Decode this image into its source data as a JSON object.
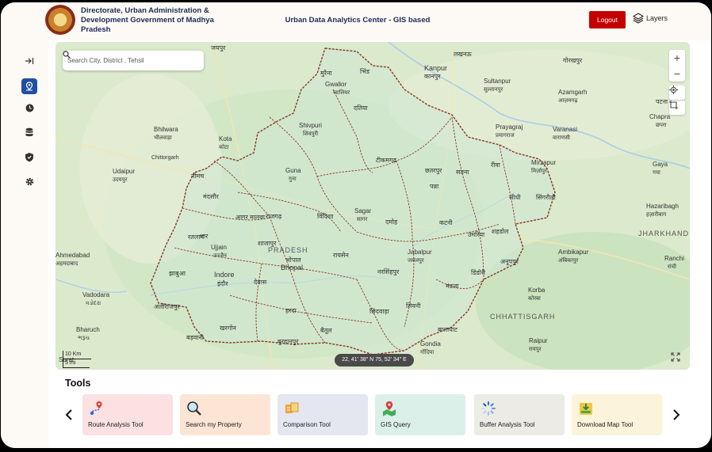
{
  "header": {
    "org_name": "Directorate, Urban Administration & Development Government of Madhya Pradesh",
    "app_title": "Urban Data Analytics Center - GIS based",
    "logout_label": "Logout",
    "layers_label": "Layers"
  },
  "search": {
    "placeholder": "Search City, District , Tehsil"
  },
  "map": {
    "scale_km": "10 Km",
    "scale_mi": "5 mi",
    "coordinates": "22, 41' 38\" N 75, 52' 34\" E",
    "labels": {
      "kanpur": "Kanpur",
      "kanpur_hi": "कानपुर",
      "lucknow": "लखनऊ",
      "gorakhpur": "गोरखपुर",
      "sultanpur": "Sultanpur",
      "sultanpur_hi": "सुल्तानपुर",
      "azamgarh": "Azamgarh",
      "azamgarh_hi": "आज़मगढ़",
      "prayagraj": "Prayagraj",
      "prayagraj_hi": "प्रयागराज",
      "varanasi": "Varanasi",
      "varanasi_hi": "वाराणसी",
      "chapra": "Chapra",
      "chapra_hi": "छपरा",
      "patna": "पटना",
      "mirzapur": "Mirzapur",
      "mirzapur_hi": "मिर्ज़ापुर",
      "gaya": "Gaya",
      "gaya_hi": "गया",
      "hazaribagh": "Hazaribagh",
      "hazaribagh_hi": "हज़ारीबाग",
      "jharkhand": "JHARKHAND",
      "ranchi": "Ranchi",
      "ranchi_hi": "रांची",
      "ambikapur": "Ambikapur",
      "ambikapur_hi": "अंबिकापुर",
      "korba": "Korba",
      "korba_hi": "कोरबा",
      "chhattisgarh": "CHHATTISGARH",
      "raipur": "Raipur",
      "raipur_hi": "रायपुर",
      "gondia": "Gondia",
      "gondia_hi": "गोंदिया",
      "ahmedabad": "Ahmedabad",
      "ahmedabad_hi": "अहमदाबाद",
      "vadodara": "Vadodara",
      "vadodara_hi": "વડોદરા",
      "bharuch": "Bharuch",
      "bharuch_hi": "ભરૂચ",
      "surat": "Surat",
      "surat_hi": "સુરત",
      "udaipur": "Udaipur",
      "udaipur_hi": "उदयपुर",
      "bhilwara": "Bhilwara",
      "bhilwara_hi": "भीलवाड़ा",
      "chittorgarh": "Chittorgarh",
      "kota": "Kota",
      "kota_hi": "कोटा",
      "jaipur": "जयपुर",
      "madhya_pradesh": "PRADESH",
      "indore": "Indore",
      "indore_hi": "इंदौर",
      "bhopal": "Bhopal",
      "bhopal_hi": "भोपाल",
      "jabalpur": "Jabalpur",
      "jabalpur_hi": "जबलपुर",
      "sagar": "Sagar",
      "sagar_hi": "सागर",
      "gwalior": "Gwalior",
      "gwalior_hi": "ग्वालियर",
      "ujjain": "Ujjain",
      "ujjain_hi": "उज्जैन",
      "guna": "Guna",
      "guna_hi": "गुना",
      "shivpuri": "Shivpuri",
      "shivpuri_hi": "शिवपुरी",
      "satna": "सतना",
      "rewa": "रीवा",
      "katni": "कटनी",
      "umaria": "उमरिया",
      "shahdol": "शहडोल",
      "anuppur": "अनूपपुर",
      "dindori": "डिंडोरी",
      "mandla": "मंडला",
      "seoni": "सिवनी",
      "balaghat": "बालाघाट",
      "chhindwara": "छिंदवाड़ा",
      "betul": "बैतूल",
      "harda": "हरदा",
      "narsinghpur": "नरसिंहपुर",
      "raisen": "रायसेन",
      "vidisha": "विदिशा",
      "dewas": "देवास",
      "dhar": "धार",
      "jhabua": "झाबुआ",
      "ratlam": "रतलाम",
      "mandsaur": "मंदसौर",
      "neemuch": "नीमच",
      "khargone": "खरगोन",
      "barwani": "बड़वानी",
      "burhanpur": "बुरहानपुर",
      "damoh": "दमोह",
      "chhatarpur": "छतरपुर",
      "panna": "पन्ना",
      "tikamgarh": "टीकमगढ़",
      "sidhi": "सीधी",
      "singrauli": "सिंगरौली",
      "alirajpur": "अलीराजपुर",
      "shajapur": "शाजापुर",
      "rajgarh": "राजगढ़",
      "agar": "आगर मालवा",
      "bhind": "भिंड",
      "morena": "मुरैना",
      "datia": "दतिया"
    }
  },
  "tools": {
    "title": "Tools",
    "items": [
      {
        "label": "Route Analysis Tool",
        "icon": "route-pin-icon",
        "bg": "#fbe1e1"
      },
      {
        "label": "Search my Property",
        "icon": "magnifier-icon",
        "bg": "#fde5d6"
      },
      {
        "label": "Comparison Tool",
        "icon": "compare-icon",
        "bg": "#e4e7f0"
      },
      {
        "label": "GIS Query",
        "icon": "map-pin-icon",
        "bg": "#dcf0ea"
      },
      {
        "label": "Buffer Analysis Tool",
        "icon": "loader-icon",
        "bg": "#ecebe6"
      },
      {
        "label": "Download Map Tool",
        "icon": "download-icon",
        "bg": "#fbf4da"
      }
    ]
  },
  "colors": {
    "accent": "#1f4fa3",
    "logout": "#c50000",
    "district_border": "#8a3a2a"
  }
}
